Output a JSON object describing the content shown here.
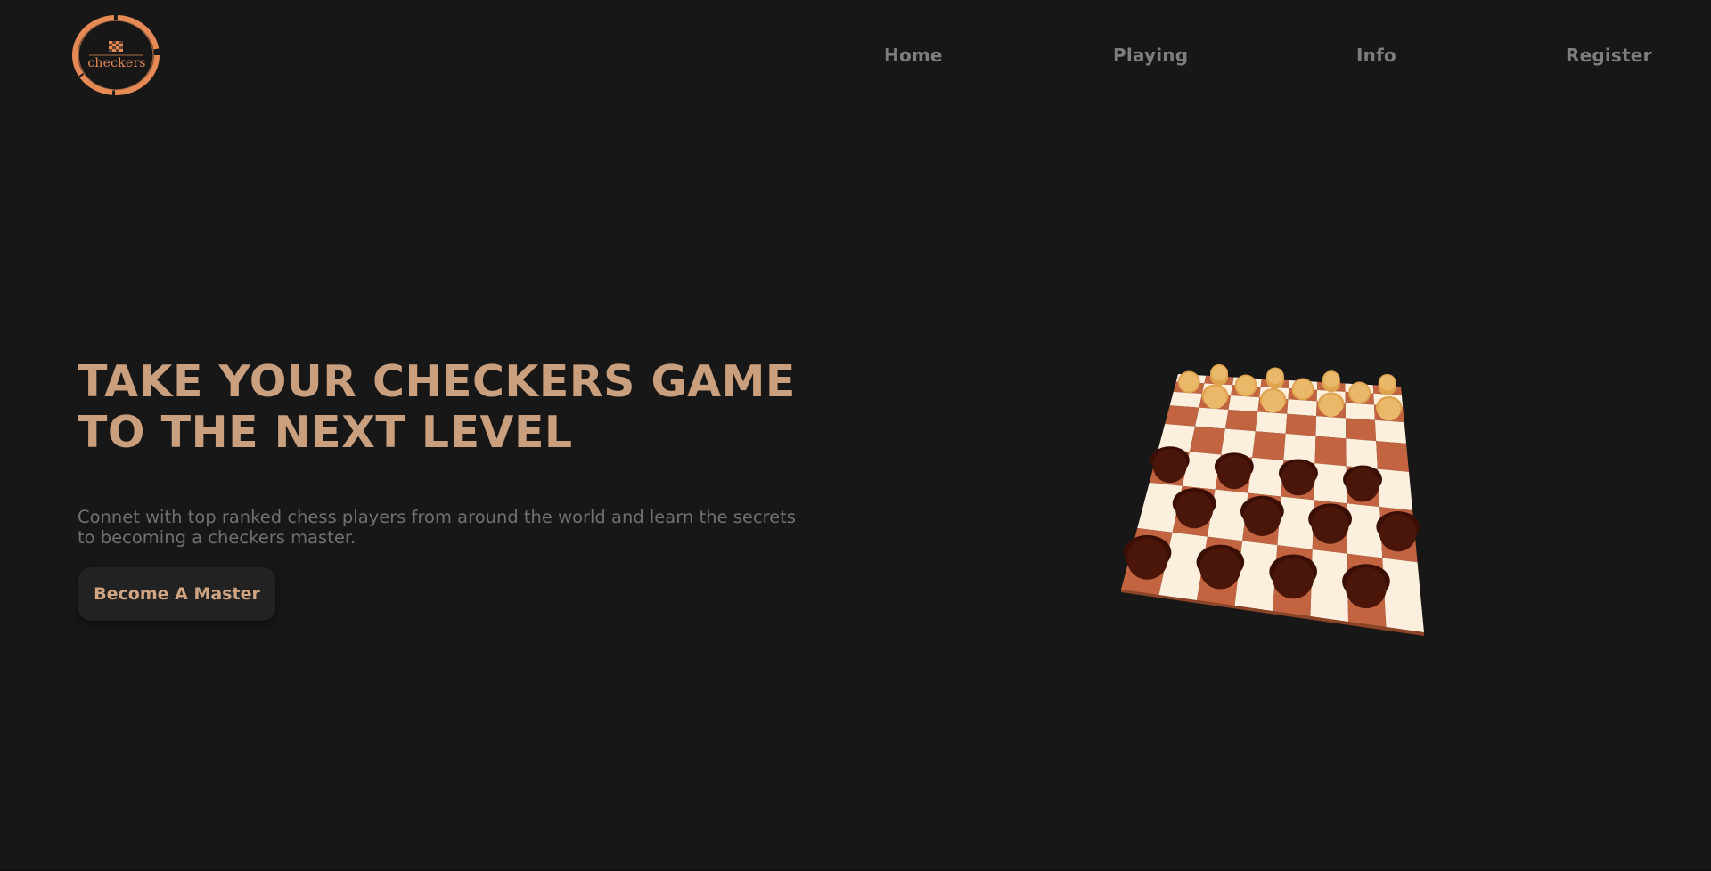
{
  "colors": {
    "background": "#171717",
    "accent": "#c99f7e",
    "nav_text": "#7d7d7d",
    "logo_ring": "#e58a55",
    "board_light": "#fdefdd",
    "board_dark": "#c36440",
    "piece_light": "#dfa34f",
    "piece_dark": "#3b0e05"
  },
  "header": {
    "logo": {
      "icon": "checkerboard-icon",
      "text": "checkers"
    },
    "nav": [
      {
        "label": "Home"
      },
      {
        "label": "Playing"
      },
      {
        "label": "Info"
      },
      {
        "label": "Register"
      }
    ]
  },
  "hero": {
    "title_lines": [
      "TAKE YOUR CHECKERS GAME",
      "TO THE NEXT LEVEL"
    ],
    "subtitle_lines": [
      "Connet with top ranked chess players from around the world and learn the secrets",
      "to becoming a checkers master."
    ],
    "cta_label": "Become A Master"
  },
  "board": {
    "size": 8,
    "light_pieces": 12,
    "dark_pieces": 12
  }
}
